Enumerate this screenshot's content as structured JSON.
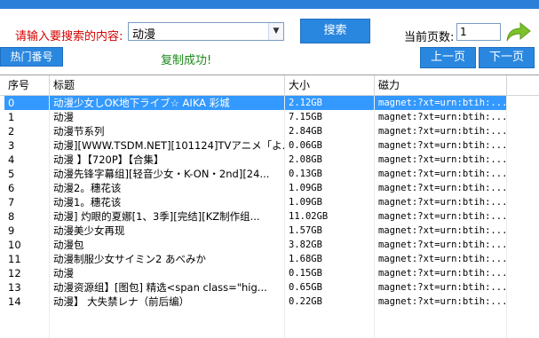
{
  "search": {
    "label": "请输入要搜索的内容:",
    "value": "动漫",
    "button": "搜索"
  },
  "paging": {
    "label": "当前页数:",
    "value": "1",
    "prev": "上一页",
    "next": "下一页"
  },
  "hot_button": "热门番号",
  "status_message": "复制成功!",
  "columns": [
    "序号",
    "标题",
    "大小",
    "磁力"
  ],
  "rows": [
    {
      "idx": "0",
      "title": "动漫少女しOK地下ライブ☆ AIKA 彩城",
      "size": "2.12GB",
      "magnet": "magnet:?xt=urn:btih:...",
      "selected": true
    },
    {
      "idx": "1",
      "title": "动漫",
      "size": "7.15GB",
      "magnet": "magnet:?xt=urn:btih:..."
    },
    {
      "idx": "2",
      "title": "动漫节系列",
      "size": "2.84GB",
      "magnet": "magnet:?xt=urn:btih:..."
    },
    {
      "idx": "3",
      "title": "动漫][WWW.TSDM.NET][101124]TVアニメ「よ...",
      "size": "0.06GB",
      "magnet": "magnet:?xt=urn:btih:..."
    },
    {
      "idx": "4",
      "title": "动漫 】【720P】【合集】",
      "size": "2.08GB",
      "magnet": "magnet:?xt=urn:btih:..."
    },
    {
      "idx": "5",
      "title": "动漫先锋字幕组][轻音少女・K-ON・2nd][24...",
      "size": "0.13GB",
      "magnet": "magnet:?xt=urn:btih:..."
    },
    {
      "idx": "6",
      "title": "动漫2。穗花该",
      "size": "1.09GB",
      "magnet": "magnet:?xt=urn:btih:..."
    },
    {
      "idx": "7",
      "title": "动漫1。穗花该",
      "size": "1.09GB",
      "magnet": "magnet:?xt=urn:btih:..."
    },
    {
      "idx": "8",
      "title": "动漫] 灼眼的夏娜[1、3季][完结][KZ制作组...",
      "size": "11.02GB",
      "magnet": "magnet:?xt=urn:btih:..."
    },
    {
      "idx": "9",
      "title": "动漫美少女再现",
      "size": "1.57GB",
      "magnet": "magnet:?xt=urn:btih:..."
    },
    {
      "idx": "10",
      "title": "动漫包",
      "size": "3.82GB",
      "magnet": "magnet:?xt=urn:btih:..."
    },
    {
      "idx": "11",
      "title": "动漫制服少女サイミン2 あべみか",
      "size": "1.68GB",
      "magnet": "magnet:?xt=urn:btih:..."
    },
    {
      "idx": "12",
      "title": "动漫",
      "size": "0.15GB",
      "magnet": "magnet:?xt=urn:btih:..."
    },
    {
      "idx": "13",
      "title": "动漫资源组】[图包] 精选<span class=\"hig...",
      "size": "0.65GB",
      "magnet": "magnet:?xt=urn:btih:..."
    },
    {
      "idx": "14",
      "title": "动漫】 大失禁レナ（前后编）",
      "size": "0.22GB",
      "magnet": "magnet:?xt=urn:btih:..."
    }
  ],
  "colors": {
    "accent": "#2a87e0",
    "selection": "#3399ff",
    "label_red": "#d40000",
    "status_green": "#1a8a1a",
    "go_arrow": "#7cc22a"
  },
  "icons": {
    "go": "go-arrow-icon",
    "dropdown": "chevron-down-icon"
  }
}
